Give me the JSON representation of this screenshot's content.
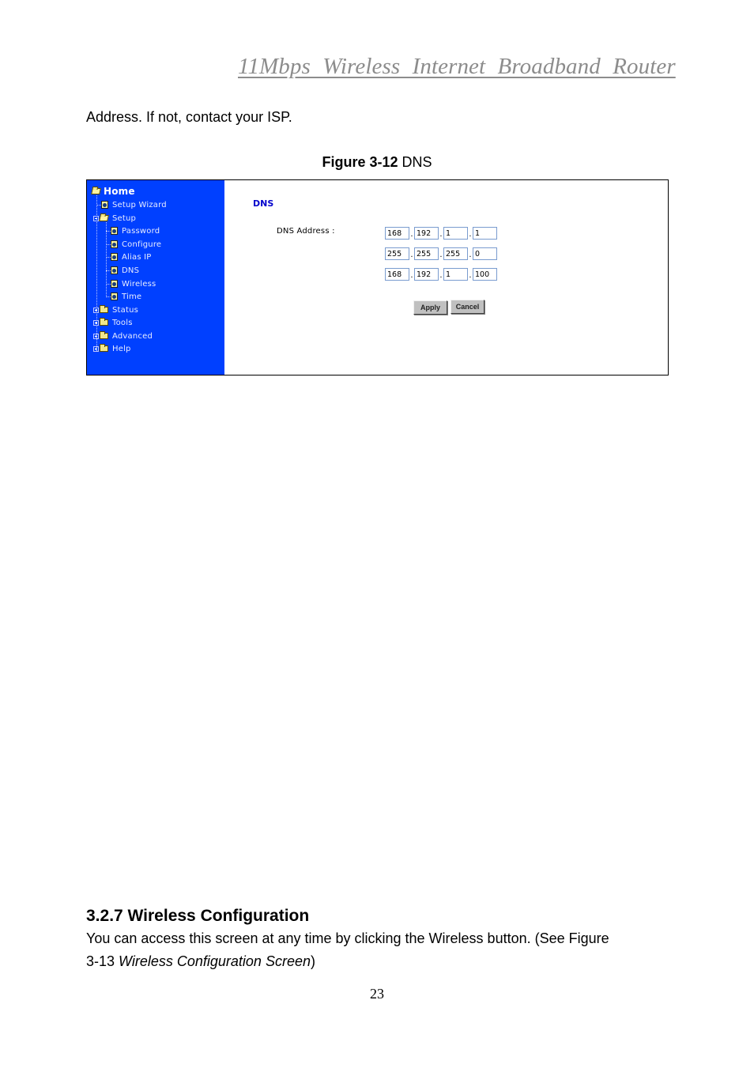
{
  "header": {
    "running_title": "11Mbps  Wireless  Internet  Broadband  Router"
  },
  "intro_text": "Address. If not, contact your ISP.",
  "figure": {
    "caption_bold": "Figure 3-12",
    "caption_rest": " DNS",
    "sidebar": {
      "home": "Home",
      "items": [
        {
          "label": "Setup Wizard",
          "icon": "page-icon"
        },
        {
          "label": "Setup",
          "icon": "folder-open-icon"
        },
        {
          "label": "Password",
          "icon": "page-icon"
        },
        {
          "label": "Configure",
          "icon": "page-icon"
        },
        {
          "label": "Alias IP",
          "icon": "page-icon"
        },
        {
          "label": "DNS",
          "icon": "page-icon"
        },
        {
          "label": "Wireless",
          "icon": "page-icon"
        },
        {
          "label": "Time",
          "icon": "page-icon"
        },
        {
          "label": "Status",
          "icon": "folder-icon"
        },
        {
          "label": "Tools",
          "icon": "folder-icon"
        },
        {
          "label": "Advanced",
          "icon": "folder-icon"
        },
        {
          "label": "Help",
          "icon": "folder-icon"
        }
      ]
    },
    "content": {
      "title": "DNS",
      "dns_label": "DNS Address :",
      "rows": [
        [
          "168",
          "192",
          "1",
          "1"
        ],
        [
          "255",
          "255",
          "255",
          "0"
        ],
        [
          "168",
          "192",
          "1",
          "100"
        ]
      ],
      "ip_separator": ".",
      "apply_label": "Apply",
      "cancel_label": "Cancel"
    }
  },
  "section": {
    "heading": "3.2.7 Wireless Configuration",
    "para_line1": "You can access this screen at any time by clicking the Wireless button. (See Figure",
    "para_line2_prefix": "3-13 ",
    "para_line2_italic": "Wireless Configuration Screen",
    "para_line2_suffix": ")"
  },
  "page_number": "23"
}
